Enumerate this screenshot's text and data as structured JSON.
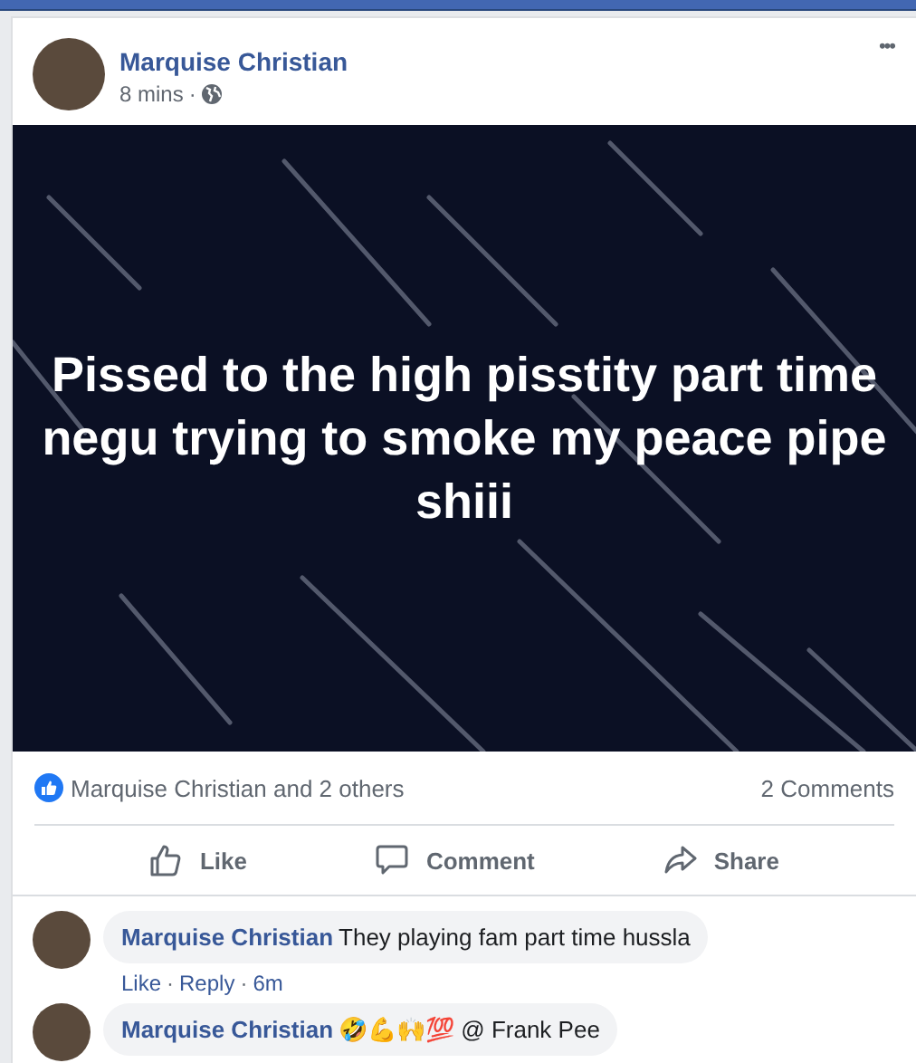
{
  "post": {
    "author": "Marquise Christian",
    "time": "8 mins",
    "separator": "·",
    "menu": "•••",
    "text": "Pissed to the high pisstity part time negu trying to smoke my peace pipe shiii"
  },
  "reactions": {
    "summary": "Marquise Christian and 2 others",
    "comments_count": "2 Comments"
  },
  "actions": [
    {
      "kind": "like",
      "label": "Like"
    },
    {
      "kind": "comment",
      "label": "Comment"
    },
    {
      "kind": "share",
      "label": "Share"
    }
  ],
  "comments": [
    {
      "author": "Marquise Christian",
      "text": "They playing fam part time hussla",
      "links": [
        {
          "label": "Like"
        },
        {
          "label": "Reply"
        },
        {
          "label": "6m"
        }
      ]
    },
    {
      "author": "Marquise Christian",
      "text": "🤣💪🙌💯 @ Frank Pee"
    }
  ]
}
